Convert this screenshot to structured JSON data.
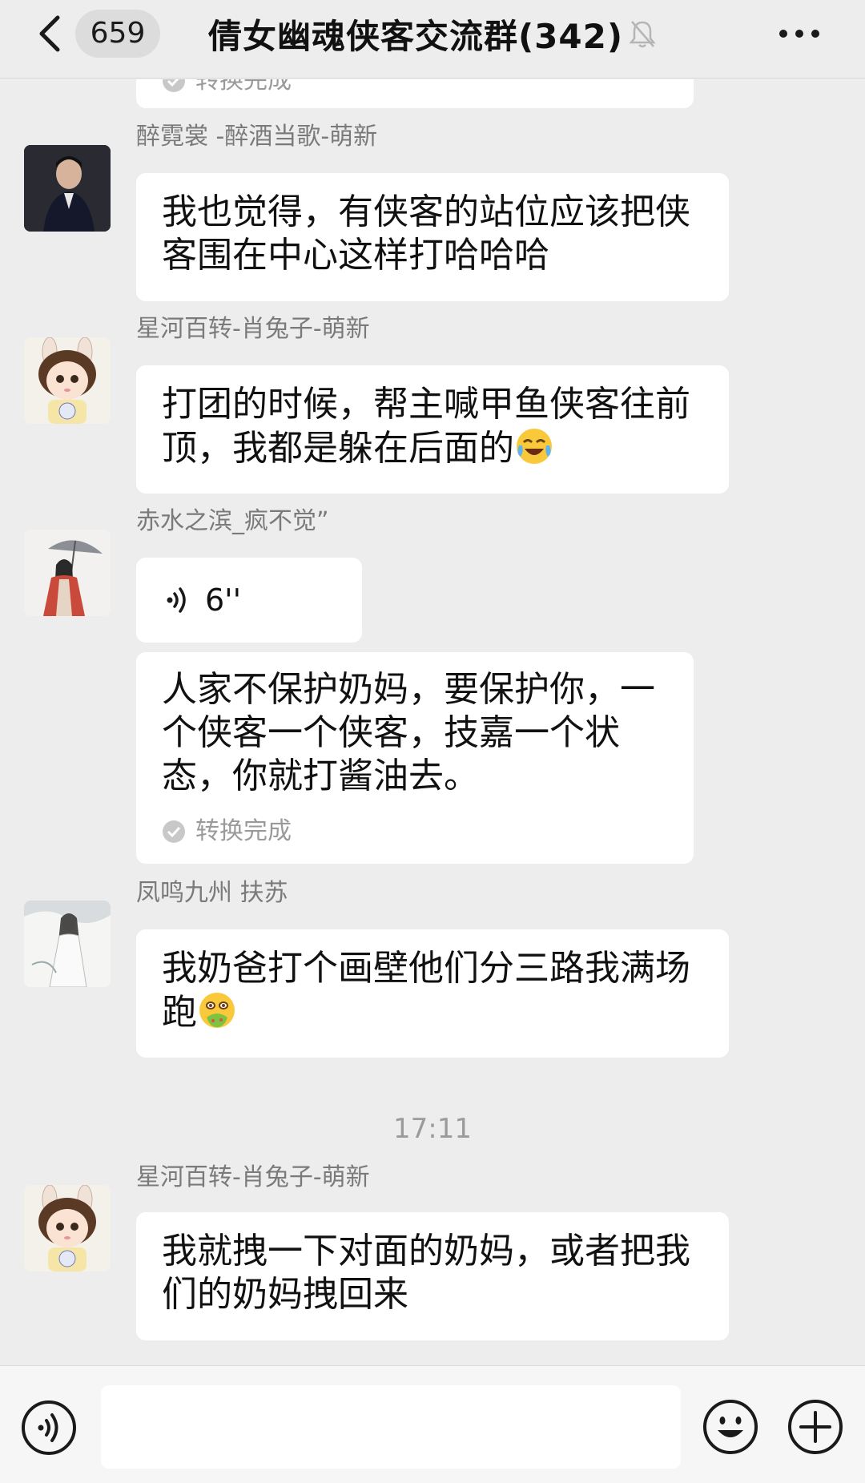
{
  "header": {
    "unread_count": "659",
    "title": "倩女幽魂侠客交流群(342)"
  },
  "messages": {
    "partial_status": "转换完成",
    "m1": {
      "sender": "醉霓裳 -醉酒当歌-萌新",
      "text": "我也觉得，有侠客的站位应该把侠客围在中心这样打哈哈哈"
    },
    "m2": {
      "sender": "星河百转-肖兔子-萌新",
      "text": "打团的时候，帮主喊甲鱼侠客往前顶，我都是躲在后面的"
    },
    "m3": {
      "sender": "赤水之滨_疯不觉”",
      "voice_duration": "6''",
      "transcript": "人家不保护奶妈，要保护你，一个侠客一个侠客，技嘉一个状态，你就打酱油去。",
      "status": "转换完成"
    },
    "m4": {
      "sender": "凤鸣九州 扶苏",
      "text": "我奶爸打个画壁他们分三路我满场跑"
    },
    "timestamp": "17:11",
    "m5": {
      "sender": "星河百转-肖兔子-萌新",
      "text": "我就拽一下对面的奶妈，或者把我们的奶妈拽回来"
    }
  },
  "input": {
    "placeholder": ""
  },
  "colors": {
    "background": "#ededed",
    "bubble": "#ffffff",
    "sender": "#7a7a7a",
    "timestamp": "#9b9b9b"
  }
}
